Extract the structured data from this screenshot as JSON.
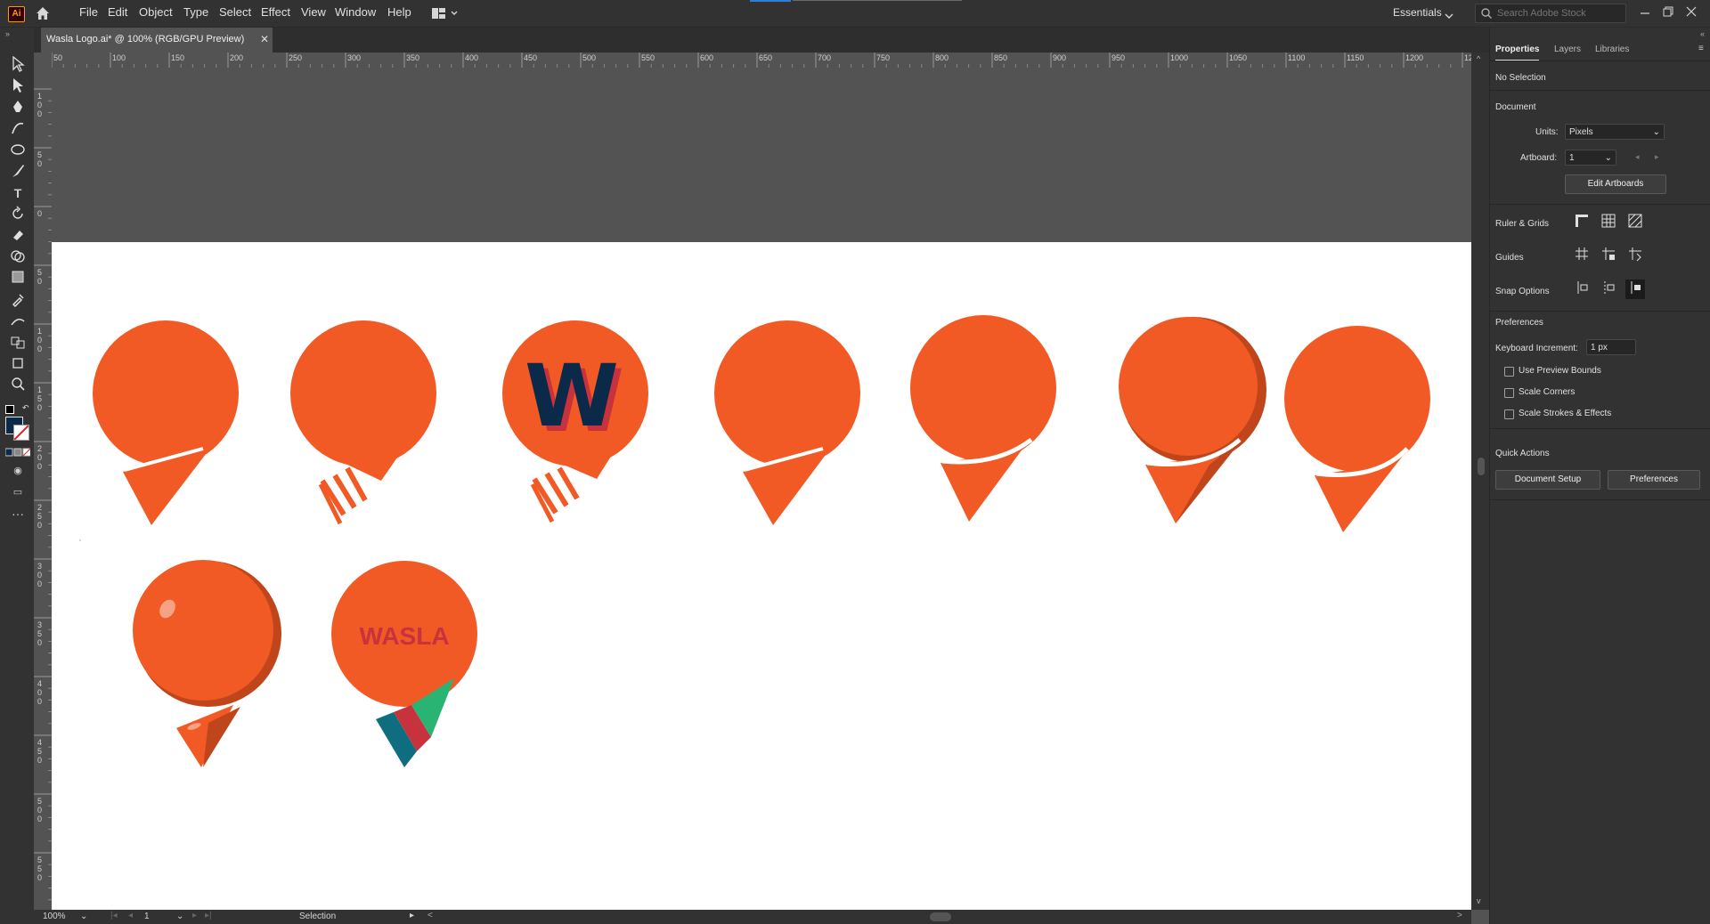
{
  "app": {
    "logo": "Ai"
  },
  "menu": [
    "File",
    "Edit",
    "Object",
    "Type",
    "Select",
    "Effect",
    "View",
    "Window",
    "Help"
  ],
  "workspace": "Essentials",
  "search": {
    "placeholder": "Search Adobe Stock"
  },
  "document": {
    "tab_title": "Wasla Logo.ai* @ 100% (RGB/GPU Preview)"
  },
  "ruler": {
    "top_labels": [
      "50",
      "100",
      "150",
      "200",
      "250",
      "300",
      "350",
      "400",
      "450",
      "500",
      "550",
      "600",
      "650",
      "700",
      "750",
      "800",
      "850",
      "900",
      "950",
      "1000",
      "1050",
      "1100",
      "1150",
      "1200",
      "12"
    ],
    "left_labels": [
      "100",
      "50",
      "0",
      "50",
      "100",
      "150",
      "200",
      "250",
      "300",
      "350",
      "400",
      "450",
      "500",
      "550"
    ]
  },
  "panel": {
    "tabs": [
      "Properties",
      "Layers",
      "Libraries"
    ],
    "selection": "No Selection",
    "document_heading": "Document",
    "units_label": "Units:",
    "units_value": "Pixels",
    "artboard_label": "Artboard:",
    "artboard_value": "1",
    "edit_artboards": "Edit Artboards",
    "ruler_grids": "Ruler & Grids",
    "guides": "Guides",
    "snap_options": "Snap Options",
    "preferences_heading": "Preferences",
    "keyboard_increment_label": "Keyboard Increment:",
    "keyboard_increment_value": "1 px",
    "use_preview_bounds": "Use Preview Bounds",
    "scale_corners": "Scale Corners",
    "scale_strokes": "Scale Strokes & Effects",
    "quick_actions": "Quick Actions",
    "document_setup": "Document Setup",
    "preferences_button": "Preferences"
  },
  "status": {
    "zoom": "100%",
    "artboard": "1",
    "tool": "Selection"
  },
  "artwork": {
    "colors": {
      "orange": "#f15a24",
      "dark_orange": "#c1451b",
      "navy": "#0b2a4a",
      "red": "#c8323c",
      "teal": "#0e6e80",
      "green": "#29b473"
    },
    "w_letter": "W",
    "wasla_text": "WASLA"
  }
}
